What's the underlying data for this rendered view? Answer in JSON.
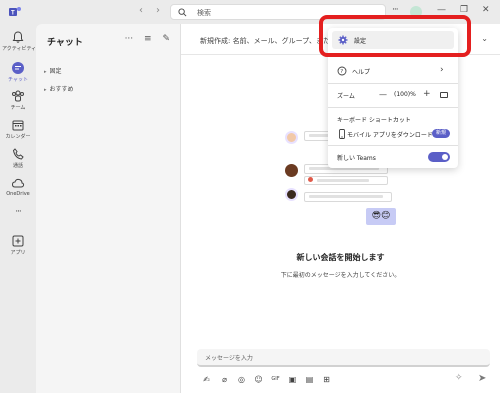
{
  "titlebar": {
    "back_glyph": "‹",
    "forward_glyph": "›",
    "search_placeholder": "検索",
    "more_glyph": "···",
    "minimize_glyph": "—",
    "maximize_glyph": "❐",
    "close_glyph": "✕"
  },
  "rail": {
    "items": [
      {
        "label": "アクティビティ",
        "icon": "bell-icon"
      },
      {
        "label": "チャット",
        "icon": "chat-icon"
      },
      {
        "label": "チーム",
        "icon": "teams-icon"
      },
      {
        "label": "カレンダー",
        "icon": "calendar-icon"
      },
      {
        "label": "通話",
        "icon": "phone-icon"
      },
      {
        "label": "OneDrive",
        "icon": "cloud-icon"
      },
      {
        "label": "",
        "icon": "more-icon"
      },
      {
        "label": "アプリ",
        "icon": "apps-icon"
      }
    ],
    "more_glyph": "···"
  },
  "chat_pane": {
    "title": "チャット",
    "more_glyph": "···",
    "filter_glyph": "≡",
    "compose_glyph": "✎",
    "sections": [
      {
        "label": "固定"
      },
      {
        "label": "おすすめ"
      }
    ]
  },
  "main": {
    "new_chat_label": "新規作成:  名前、メール、グループ、また",
    "chevron_glyph": "⌄",
    "start_title": "新しい会話を開始します",
    "start_subtitle": "下に最初のメッセージを入力してください。",
    "composer_placeholder": "メッセージを入力",
    "emoji": "😎😊"
  },
  "menu": {
    "settings_label": "設定",
    "help_label": "ヘルプ",
    "help_chevron": "›",
    "zoom_label": "ズーム",
    "zoom_minus": "—",
    "zoom_value": "(100)%",
    "zoom_plus": "+",
    "shortcuts_label": "キーボード ショートカット",
    "mobile_label": "モバイル アプリをダウンロード",
    "mobile_badge": "新規",
    "new_teams_label": "新しい Teams",
    "new_teams_enabled": true
  },
  "colors": {
    "accent": "#5b5fc7",
    "highlight": "#e41f1f"
  }
}
